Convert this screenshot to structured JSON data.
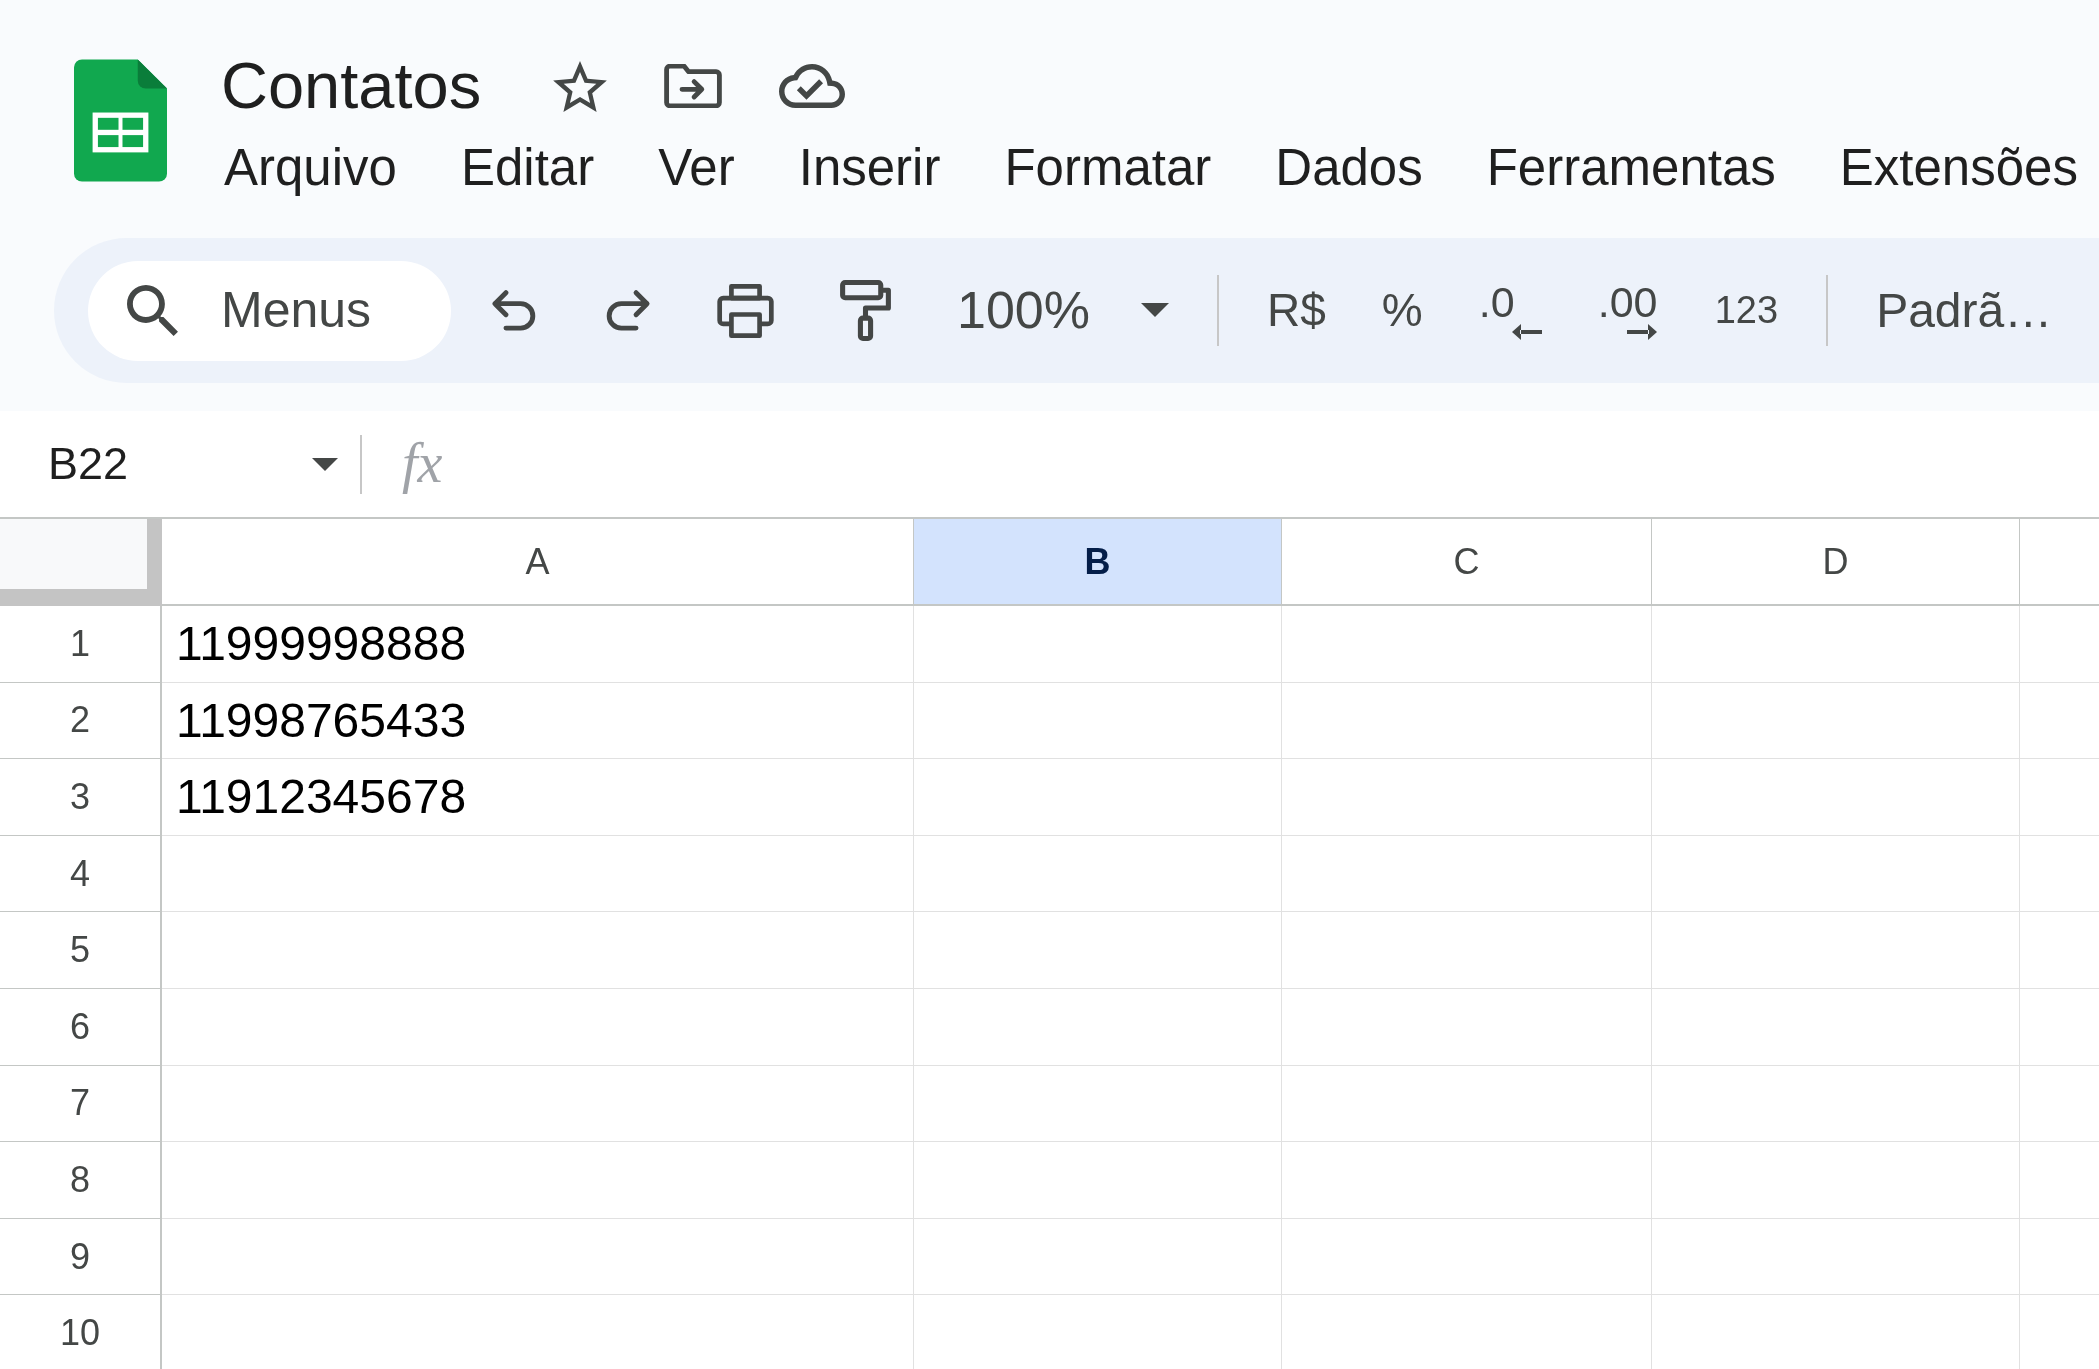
{
  "document": {
    "title": "Contatos"
  },
  "menu_bar": [
    "Arquivo",
    "Editar",
    "Ver",
    "Inserir",
    "Formatar",
    "Dados",
    "Ferramentas",
    "Extensões"
  ],
  "toolbar": {
    "search": {
      "placeholder": "Menus"
    },
    "zoom": "100%",
    "format_buttons": [
      {
        "label": "R$",
        "kind": "currency"
      },
      {
        "label": "%",
        "kind": "percent"
      },
      {
        "label": ".0",
        "kind": "decimal_decrease"
      },
      {
        "label": ".00",
        "kind": "decimal_increase"
      },
      {
        "label": "123",
        "kind": "number_format"
      }
    ],
    "font": "Padrã…"
  },
  "formula_bar": {
    "cell_reference": "B22",
    "function_label": "fx"
  },
  "sheet": {
    "columns": [
      {
        "label": "A",
        "selected": false
      },
      {
        "label": "B",
        "selected": true
      },
      {
        "label": "C",
        "selected": false
      },
      {
        "label": "D",
        "selected": false
      }
    ],
    "rows": [
      {
        "number": "1",
        "cells": [
          "11999998888"
        ]
      },
      {
        "number": "2",
        "cells": [
          "11998765433"
        ]
      },
      {
        "number": "3",
        "cells": [
          "11912345678"
        ]
      },
      {
        "number": "4"
      },
      {
        "number": "5"
      },
      {
        "number": "6"
      },
      {
        "number": "7"
      },
      {
        "number": "8"
      },
      {
        "number": "9"
      },
      {
        "number": "10"
      }
    ]
  }
}
